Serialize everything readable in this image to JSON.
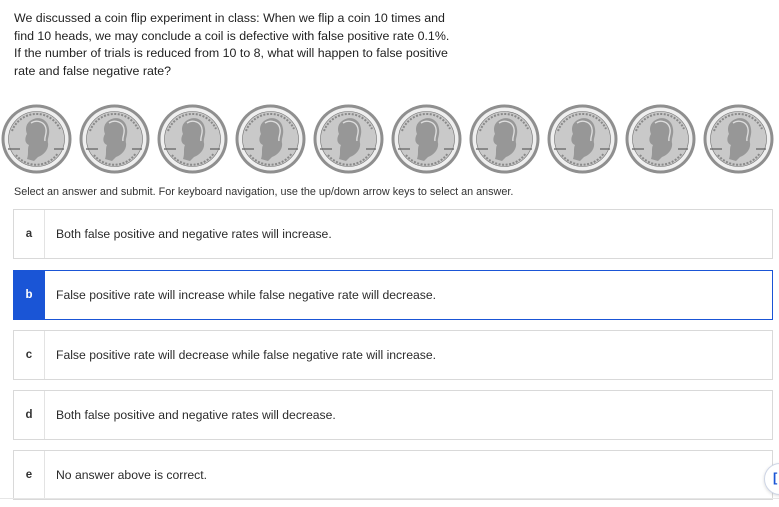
{
  "question": {
    "text": "We discussed a coin flip experiment in class: When we flip a coin 10 times and find 10 heads, we may conclude a coil is defective with false positive rate 0.1%. If the number of trials is reduced from 10 to 8, what will happen to false positive rate and false negative rate?"
  },
  "coins": {
    "count": 10,
    "icon": "quarter-coin-icon",
    "colors": {
      "rim": "#8f8f8f",
      "face": "#c9c9c9",
      "highlight": "#efefef",
      "shadow": "#6d6d6d"
    }
  },
  "instructions": "Select an answer and submit. For keyboard navigation, use the up/down arrow keys to select an answer.",
  "answers": [
    {
      "letter": "a",
      "text": "Both false positive and negative rates will increase.",
      "selected": false
    },
    {
      "letter": "b",
      "text": "False positive rate will increase while false negative rate will decrease.",
      "selected": true
    },
    {
      "letter": "c",
      "text": "False positive rate will decrease while false negative rate will increase.",
      "selected": false
    },
    {
      "letter": "d",
      "text": "Both false positive and negative rates will decrease.",
      "selected": false
    },
    {
      "letter": "e",
      "text": "No answer above is correct.",
      "selected": false
    }
  ],
  "accent_color": "#1a55d6",
  "edge_button": {
    "icon": "bracket-icon",
    "glyph": "["
  }
}
